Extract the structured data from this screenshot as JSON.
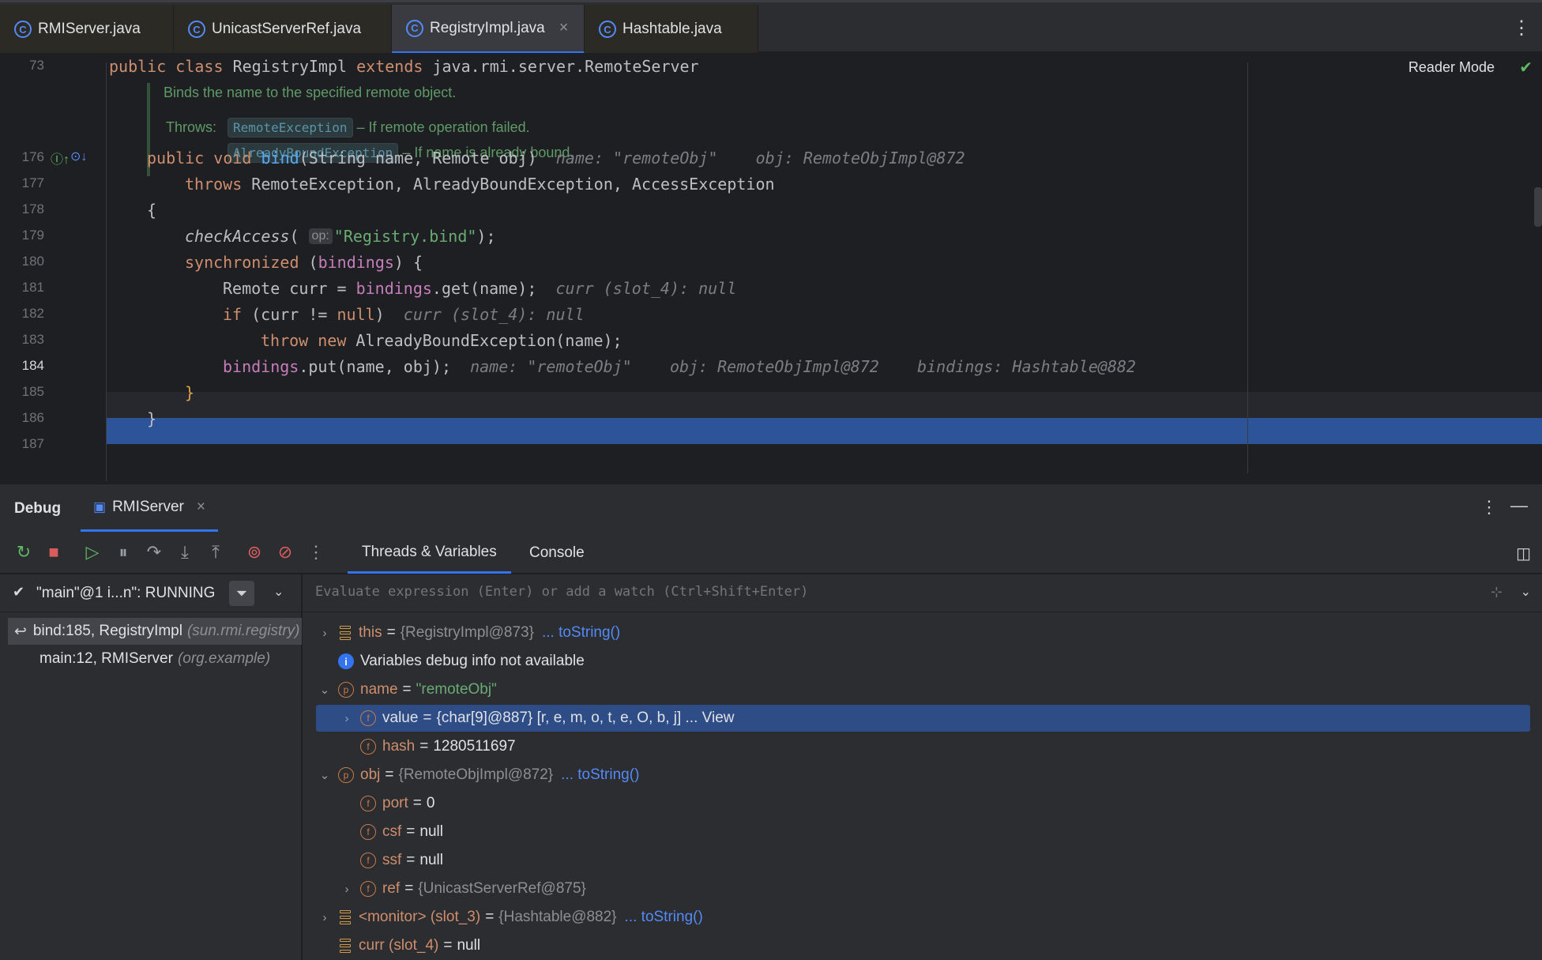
{
  "tabs": [
    {
      "label": "RMIServer.java",
      "active": false
    },
    {
      "label": "UnicastServerRef.java",
      "active": false
    },
    {
      "label": "RegistryImpl.java",
      "active": true,
      "close": "×"
    },
    {
      "label": "Hashtable.java",
      "active": false
    }
  ],
  "editor": {
    "reader_mode": "Reader Mode",
    "sticky": {
      "line": "73",
      "text_parts": [
        "public",
        "class",
        "RegistryImpl",
        "extends",
        "java.rmi.server.RemoteServer"
      ]
    },
    "doc": {
      "summary": "Binds the name to the specified remote object.",
      "throws_label": "Throws:",
      "throws": [
        {
          "name": "RemoteException",
          "desc": "– If remote operation failed."
        },
        {
          "name": "AlreadyBoundException",
          "desc": "– If name is already bound."
        }
      ]
    },
    "lines": [
      {
        "n": "176",
        "hint": "name: \"remoteObj\"    obj: RemoteObjImpl@872"
      },
      {
        "n": "177"
      },
      {
        "n": "178"
      },
      {
        "n": "179",
        "inlay": "op:"
      },
      {
        "n": "180"
      },
      {
        "n": "181",
        "hint": "curr (slot_4): null"
      },
      {
        "n": "182",
        "hint": "curr (slot_4): null"
      },
      {
        "n": "183"
      },
      {
        "n": "184",
        "hint": "name: \"remoteObj\"    obj: RemoteObjImpl@872    bindings: Hashtable@882"
      },
      {
        "n": "185"
      },
      {
        "n": "186"
      },
      {
        "n": "187"
      }
    ]
  },
  "debug": {
    "title": "Debug",
    "session": "RMIServer",
    "session_close": "×",
    "subtabs": [
      "Threads & Variables",
      "Console"
    ],
    "thread": "\"main\"@1 i...n\": RUNNING",
    "frames": [
      {
        "method": "bind:185, RegistryImpl",
        "pkg": "(sun.rmi.registry)",
        "selected": true
      },
      {
        "method": "main:12, RMIServer",
        "pkg": "(org.example)",
        "selected": false
      }
    ],
    "eval_placeholder": "Evaluate expression (Enter) or add a watch (Ctrl+Shift+Enter)",
    "variables": [
      {
        "name": "this",
        "value": "{RegistryImpl@873}",
        "link": "... toString()"
      },
      {
        "info": "Variables debug info not available"
      },
      {
        "name": "name",
        "value": "\"remoteObj\""
      },
      {
        "name": "value",
        "value": "{char[9]@887} [r, e, m, o, t, e, O, b, j] ... View"
      },
      {
        "name": "hash",
        "value": "1280511697"
      },
      {
        "name": "obj",
        "value": "{RemoteObjImpl@872}",
        "link": "... toString()"
      },
      {
        "name": "port",
        "value": "0"
      },
      {
        "name": "csf",
        "value": "null"
      },
      {
        "name": "ssf",
        "value": "null"
      },
      {
        "name": "ref",
        "value": "{UnicastServerRef@875}"
      },
      {
        "name": "<monitor> (slot_3)",
        "value": "{Hashtable@882}",
        "link": "... toString()"
      },
      {
        "name": "curr (slot_4)",
        "value": "null"
      }
    ]
  }
}
